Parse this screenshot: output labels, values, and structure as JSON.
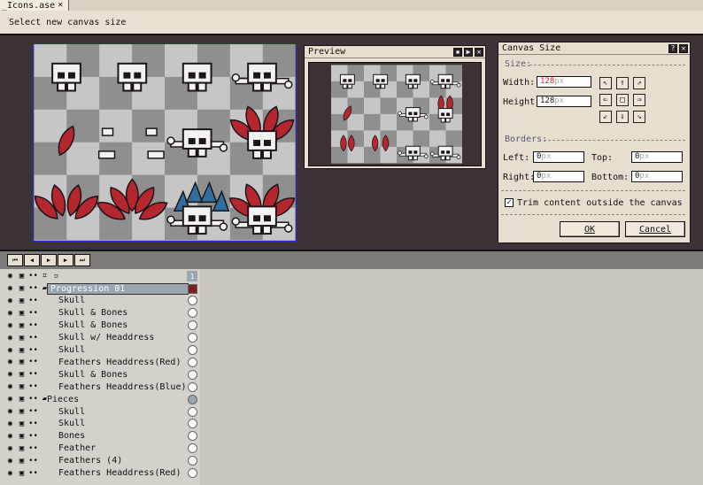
{
  "tab": {
    "label": "_Icons.ase"
  },
  "status": {
    "text": "Select new canvas size"
  },
  "preview": {
    "title": "Preview"
  },
  "dialog": {
    "title": "Canvas Size",
    "size_group": "Size:",
    "width_label": "Width:",
    "width_value": "128",
    "height_label": "Height:",
    "height_value": "128",
    "unit": "px",
    "borders_group": "Borders:",
    "left_label": "Left:",
    "left_value": "0",
    "top_label": "Top:",
    "top_value": "0",
    "right_label": "Right:",
    "right_value": "0",
    "bottom_label": "Bottom:",
    "bottom_value": "0",
    "trim_label": "Trim content outside the canvas",
    "trim_checked": true,
    "ok_label": "OK",
    "cancel_label": "Cancel"
  },
  "timeline": {
    "frame_number": "1",
    "buttons": [
      "first-frame",
      "prev-frame",
      "play",
      "next-frame",
      "last-frame"
    ],
    "layers": [
      {
        "name": "Progression 01",
        "type": "group",
        "selected": true
      },
      {
        "name": "Skull"
      },
      {
        "name": "Skull & Bones"
      },
      {
        "name": "Skull & Bones"
      },
      {
        "name": "Skull w/ Headdress"
      },
      {
        "name": "Skull"
      },
      {
        "name": "Feathers Headdress(Red)"
      },
      {
        "name": "Skull & Bones"
      },
      {
        "name": "Feathers Headdress(Blue)"
      },
      {
        "name": "Pieces",
        "type": "group"
      },
      {
        "name": "Skull"
      },
      {
        "name": "Skull"
      },
      {
        "name": "Bones"
      },
      {
        "name": "Feather"
      },
      {
        "name": "Feathers (4)"
      },
      {
        "name": "Feathers Headdress(Red)"
      }
    ]
  },
  "colors": {
    "checker_light": "#c6c6c6",
    "checker_dark": "#8f8f8f",
    "feather_red": "#b5272f",
    "feather_blue": "#2f6f9f",
    "skull": "#f2f2f2",
    "selection": "#9aa6b1"
  }
}
